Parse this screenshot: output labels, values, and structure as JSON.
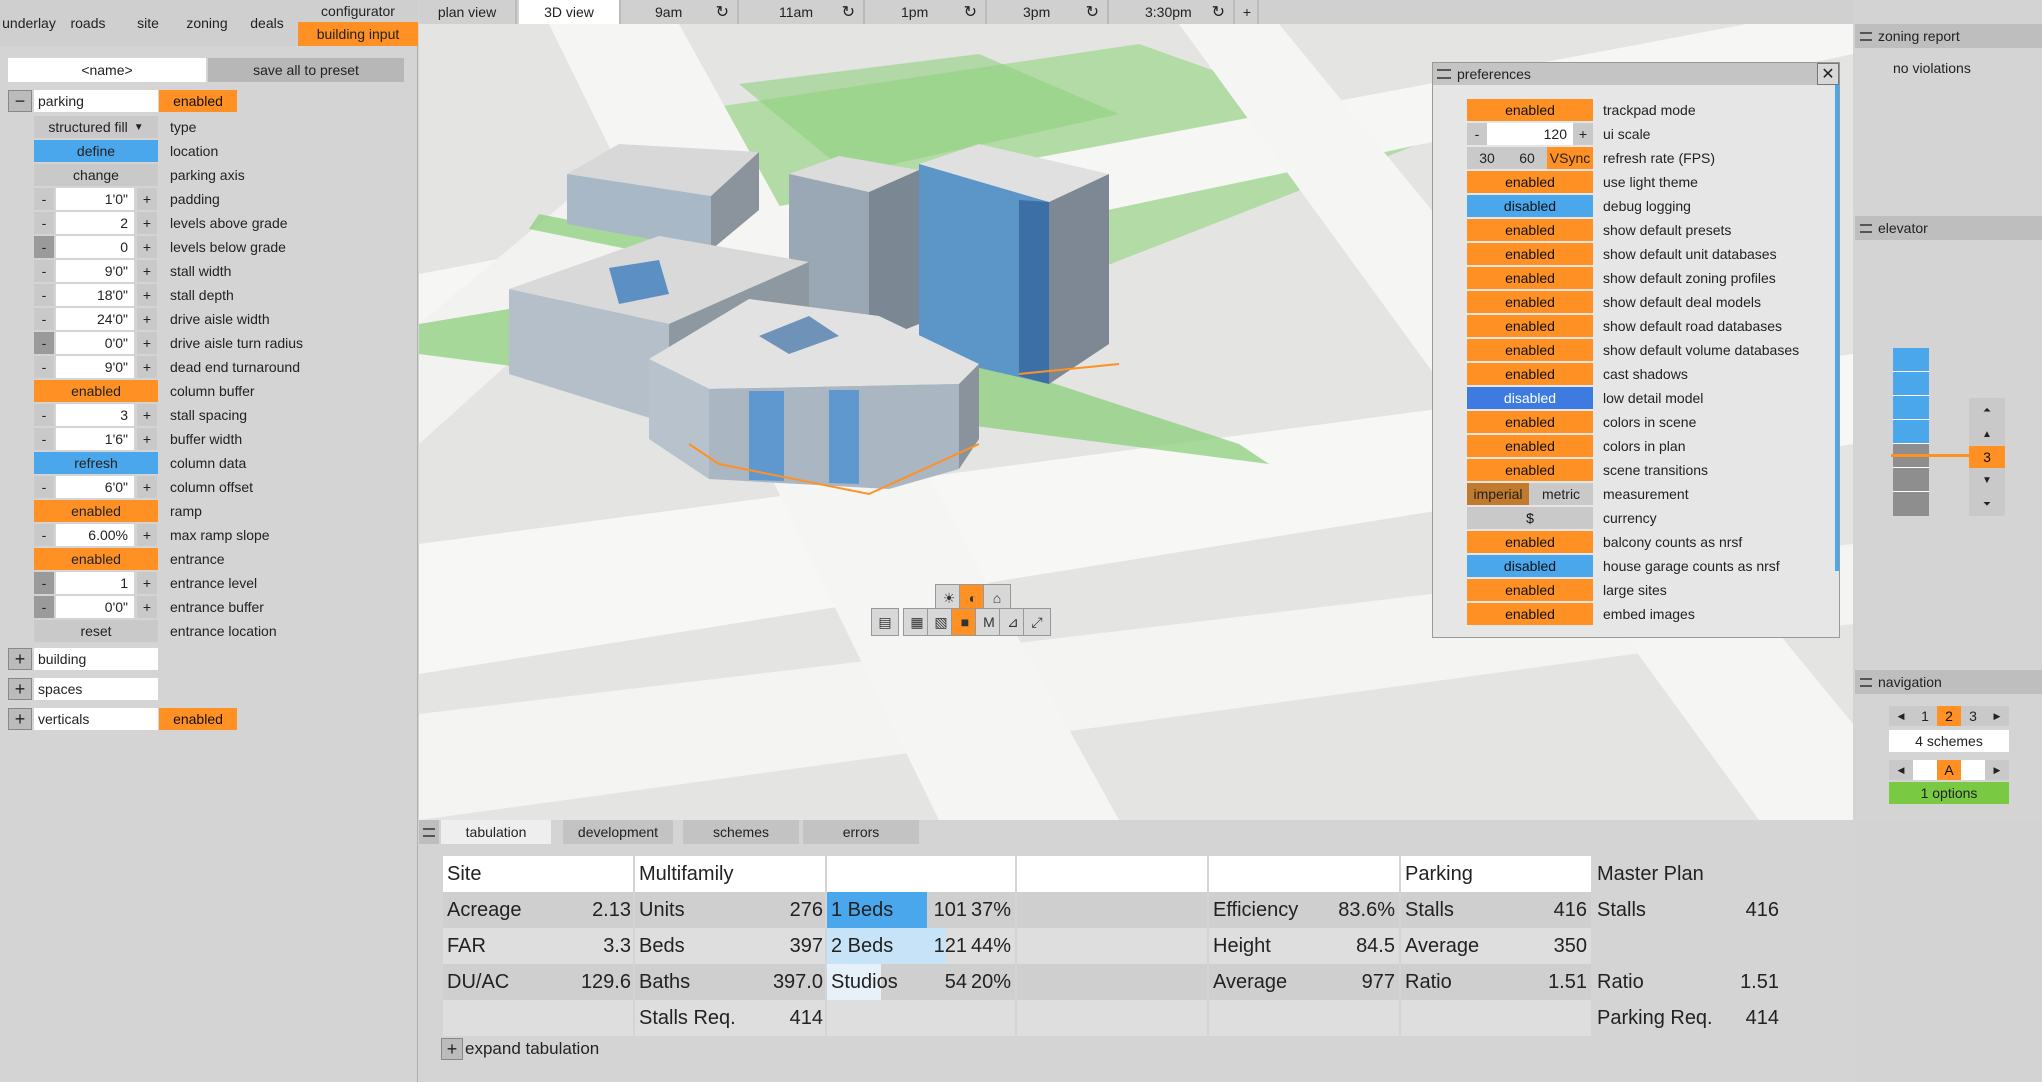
{
  "topmenu": {
    "items": [
      "underlay",
      "roads",
      "site",
      "zoning",
      "deals"
    ],
    "configurator": "configurator",
    "building_input": "building input"
  },
  "left": {
    "name_placeholder": "<name>",
    "save_preset": "save all to preset",
    "parking": {
      "title": "parking",
      "status": "enabled",
      "rows": [
        {
          "kind": "select",
          "value": "structured fill",
          "label": "type"
        },
        {
          "kind": "button",
          "value": "define",
          "style": "bl",
          "label": "location"
        },
        {
          "kind": "button",
          "value": "change",
          "style": "grey",
          "label": "parking axis"
        },
        {
          "kind": "num",
          "value": "1'0\"",
          "label": "padding"
        },
        {
          "kind": "num",
          "value": "2",
          "label": "levels above grade"
        },
        {
          "kind": "num",
          "value": "0",
          "label": "levels below grade",
          "dim": true
        },
        {
          "kind": "num",
          "value": "9'0\"",
          "label": "stall width"
        },
        {
          "kind": "num",
          "value": "18'0\"",
          "label": "stall depth"
        },
        {
          "kind": "num",
          "value": "24'0\"",
          "label": "drive aisle width"
        },
        {
          "kind": "num",
          "value": "0'0\"",
          "label": "drive aisle turn radius",
          "dim": true
        },
        {
          "kind": "num",
          "value": "9'0\"",
          "label": "dead end turnaround"
        },
        {
          "kind": "button",
          "value": "enabled",
          "style": "or",
          "label": "column buffer"
        },
        {
          "kind": "num",
          "value": "3",
          "label": "stall spacing"
        },
        {
          "kind": "num",
          "value": "1'6\"",
          "label": "buffer width"
        },
        {
          "kind": "button",
          "value": "refresh",
          "style": "bl",
          "label": "column data"
        },
        {
          "kind": "num",
          "value": "6'0\"",
          "label": "column offset"
        },
        {
          "kind": "button",
          "value": "enabled",
          "style": "or",
          "label": "ramp"
        },
        {
          "kind": "num",
          "value": "6.00%",
          "label": "max ramp slope"
        },
        {
          "kind": "button",
          "value": "enabled",
          "style": "or",
          "label": "entrance"
        },
        {
          "kind": "num",
          "value": "1",
          "label": "entrance level",
          "dim": true
        },
        {
          "kind": "num",
          "value": "0'0\"",
          "label": "entrance buffer",
          "dim": true
        },
        {
          "kind": "button",
          "value": "reset",
          "style": "grey",
          "label": "entrance location"
        }
      ]
    },
    "sections": [
      {
        "title": "building",
        "status": ""
      },
      {
        "title": "spaces",
        "status": ""
      },
      {
        "title": "verticals",
        "status": "enabled"
      }
    ]
  },
  "viewtabs": {
    "plan": "plan view",
    "view3d": "3D view",
    "times": [
      "9am",
      "11am",
      "1pm",
      "3pm",
      "3:30pm"
    ],
    "add": "+"
  },
  "prefs": {
    "title": "preferences",
    "scale_value": "120",
    "rate_options": [
      "30",
      "60",
      "VSync"
    ],
    "rows": [
      {
        "value": "enabled",
        "style": "or",
        "label": "trackpad mode"
      },
      {
        "value": "",
        "style": "scale",
        "label": "ui scale"
      },
      {
        "value": "",
        "style": "rate",
        "label": "refresh rate (FPS)"
      },
      {
        "value": "enabled",
        "style": "or",
        "label": "use light theme"
      },
      {
        "value": "disabled",
        "style": "bl",
        "label": "debug logging"
      },
      {
        "value": "enabled",
        "style": "or",
        "label": "show default presets"
      },
      {
        "value": "enabled",
        "style": "or",
        "label": "show default unit databases"
      },
      {
        "value": "enabled",
        "style": "or",
        "label": "show default zoning profiles"
      },
      {
        "value": "enabled",
        "style": "or",
        "label": "show default deal models"
      },
      {
        "value": "enabled",
        "style": "or",
        "label": "show default road databases"
      },
      {
        "value": "enabled",
        "style": "or",
        "label": "show default volume databases"
      },
      {
        "value": "enabled",
        "style": "or",
        "label": "cast shadows"
      },
      {
        "value": "disabled",
        "style": "bld",
        "label": "low detail model"
      },
      {
        "value": "enabled",
        "style": "or",
        "label": "colors in scene"
      },
      {
        "value": "enabled",
        "style": "or",
        "label": "colors in plan"
      },
      {
        "value": "enabled",
        "style": "or",
        "label": "scene transitions"
      },
      {
        "value": "",
        "style": "units",
        "label": "measurement"
      },
      {
        "value": "$",
        "style": "grey",
        "label": "currency"
      },
      {
        "value": "enabled",
        "style": "or",
        "label": "balcony counts as nrsf"
      },
      {
        "value": "disabled",
        "style": "bl",
        "label": "house garage counts as nrsf"
      },
      {
        "value": "enabled",
        "style": "or",
        "label": "large sites"
      },
      {
        "value": "enabled",
        "style": "or",
        "label": "embed images"
      }
    ],
    "imperial": "imperial",
    "metric": "metric"
  },
  "zoning": {
    "title": "zoning report",
    "status": "no violations"
  },
  "elevator": {
    "title": "elevator",
    "level": "3"
  },
  "navigation": {
    "title": "navigation",
    "pages": [
      "1",
      "2",
      "3"
    ],
    "schemes": "4 schemes",
    "option": "A",
    "options": "1 options"
  },
  "bottom": {
    "tabs": [
      "tabulation",
      "development",
      "schemes",
      "errors"
    ],
    "expand": "expand tabulation",
    "headers": {
      "site": "Site",
      "multifamily": "Multifamily",
      "parking": "Parking",
      "master": "Master Plan"
    },
    "site": [
      [
        "Acreage",
        "2.13"
      ],
      [
        "FAR",
        "3.3"
      ],
      [
        "DU/AC",
        "129.6"
      ]
    ],
    "multifamily": [
      [
        "Units",
        "276"
      ],
      [
        "Beds",
        "397"
      ],
      [
        "Baths",
        "397.0"
      ],
      [
        "Stalls Req.",
        "414"
      ]
    ],
    "mix": [
      [
        "1 Beds",
        "101",
        "37%"
      ],
      [
        "2 Beds",
        "121",
        "44%"
      ],
      [
        "Studios",
        "54",
        "20%"
      ]
    ],
    "metrics": [
      [
        "Efficiency",
        "83.6%"
      ],
      [
        "Height",
        "84.5"
      ],
      [
        "Average",
        "977"
      ]
    ],
    "parking": [
      [
        "Stalls",
        "416"
      ],
      [
        "Average",
        "350"
      ],
      [
        "Ratio",
        "1.51"
      ]
    ],
    "master": [
      [
        "Stalls",
        "416"
      ],
      [
        "Ratio",
        "1.51"
      ],
      [
        "Parking Req.",
        "414"
      ]
    ],
    "mix_fill": [
      0.37,
      0.44,
      0.2
    ]
  }
}
